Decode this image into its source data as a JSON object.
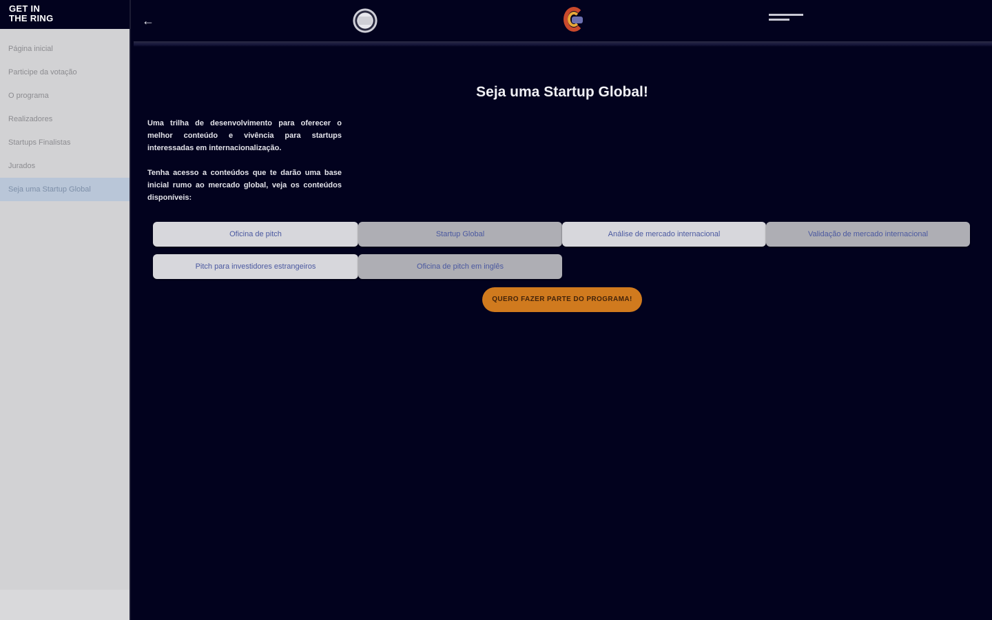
{
  "sidebar": {
    "logo": [
      "GET IN",
      "THE RING"
    ],
    "items": [
      {
        "label": "Página inicial"
      },
      {
        "label": "Participe da votação"
      },
      {
        "label": "O programa"
      },
      {
        "label": "Realizadores"
      },
      {
        "label": "Startups Finalistas"
      },
      {
        "label": "Jurados"
      },
      {
        "label": "Seja uma Startup Global"
      }
    ],
    "active_index": 6
  },
  "header": {
    "back_icon": "arrow-left-icon"
  },
  "main": {
    "title": "Seja uma Startup Global!",
    "intro": [
      "Uma trilha de desenvolvimento para oferecer o melhor conteúdo e vivência para startups interessadas em internacionalização.",
      "Tenha acesso a conteúdos que te darão uma base inicial rumo ao mercado global, veja os conteúdos disponíveis:"
    ],
    "buttons": [
      {
        "label": "Oficina de pitch"
      },
      {
        "label": "Startup Global"
      },
      {
        "label": "Análise de mercado internacional"
      },
      {
        "label": "Validação de mercado internacional"
      },
      {
        "label": "Pitch para investidores estrangeiros"
      },
      {
        "label": "Oficina de pitch em inglês"
      }
    ],
    "cta_label": "QUERO FAZER PARTE DO PROGRAMA!"
  },
  "colors": {
    "background": "#02021e",
    "sidebar": "#d2d2d4",
    "sidebar_active": "#b9c6d8",
    "button_text": "#4a58a0",
    "cta": "#d07a1e"
  }
}
